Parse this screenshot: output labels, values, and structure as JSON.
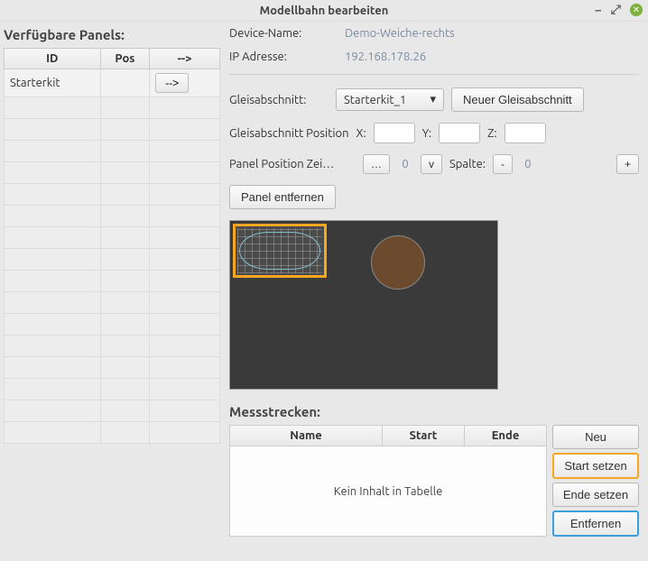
{
  "window": {
    "title": "Modellbahn bearbeiten"
  },
  "left": {
    "heading": "Verfügbare Panels:",
    "cols": {
      "id": "ID",
      "pos": "Pos",
      "arrow": "-->"
    },
    "rows": [
      {
        "id": "Starterkit",
        "pos": "",
        "arrow": "-->"
      }
    ]
  },
  "device": {
    "name_label": "Device-Name:",
    "name_value": "Demo-Weiche-rechts",
    "ip_label": "IP Adresse:",
    "ip_value": "192.168.178.26"
  },
  "track": {
    "section_label": "Gleisabschnitt:",
    "section_value": "Starterkit_1",
    "new_section_btn": "Neuer Gleisabschnitt",
    "pos_label": "Gleisabschnitt Position",
    "x": "X:",
    "y": "Y:",
    "z": "Z:",
    "panel_pos_label": "Panel Position  Zei…",
    "dots": "…",
    "row_value": "0",
    "v_btn": "v",
    "col_label": "Spalte:",
    "minus": "-",
    "col_value": "0",
    "plus": "+",
    "remove_panel_btn": "Panel entfernen"
  },
  "meas": {
    "heading": "Messstrecken:",
    "cols": {
      "name": "Name",
      "start": "Start",
      "end": "Ende"
    },
    "empty_text": "Kein Inhalt in Tabelle",
    "btns": {
      "new": "Neu",
      "start": "Start setzen",
      "end": "Ende setzen",
      "remove": "Entfernen"
    }
  }
}
